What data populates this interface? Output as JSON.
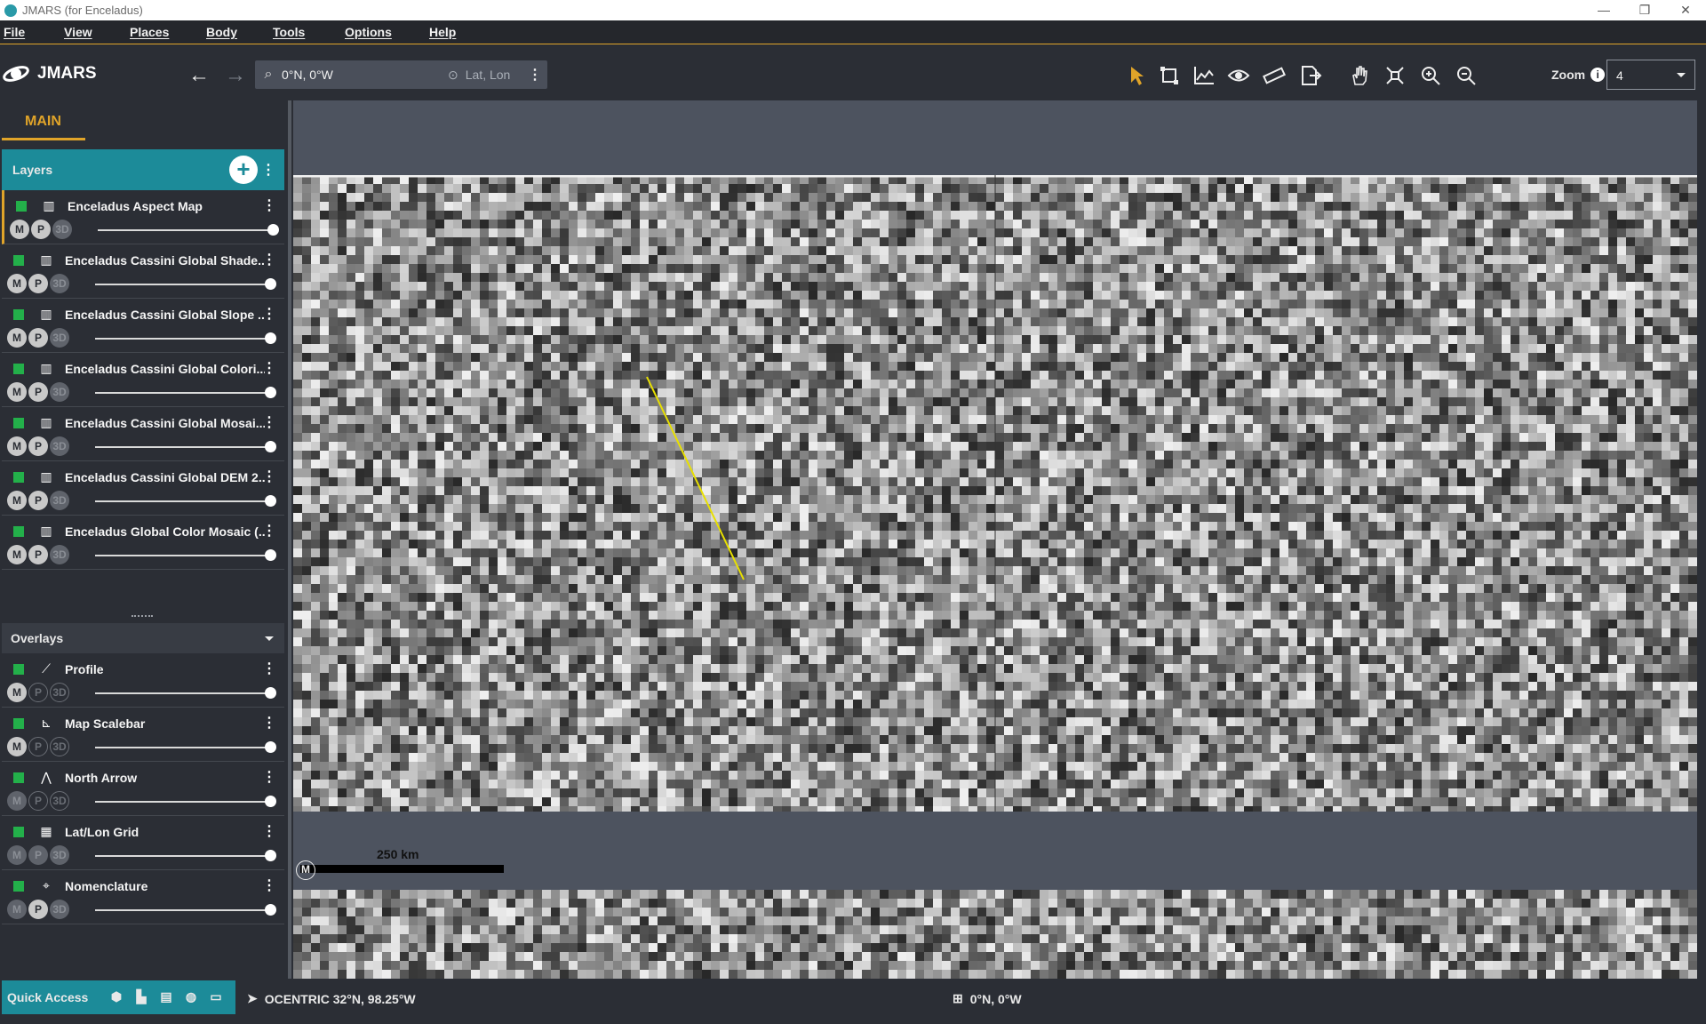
{
  "window": {
    "title": "JMARS (for Enceladus)",
    "controls": [
      "—",
      "❐",
      "✕"
    ]
  },
  "menu": [
    "File",
    "View",
    "Places",
    "Body",
    "Tools",
    "Options",
    "Help"
  ],
  "app": {
    "logo_text": "JMARS"
  },
  "search": {
    "value": "0°N, 0°W",
    "mode": "Lat, Lon"
  },
  "zoom": {
    "label": "Zoom",
    "value": "4"
  },
  "tabs": {
    "main": "MAIN"
  },
  "layers_header": "Layers",
  "layers": [
    {
      "name": "Enceladus Aspect Map",
      "badges": [
        "M",
        "P",
        "3D"
      ]
    },
    {
      "name": "Enceladus Cassini Global Shade...",
      "badges": [
        "M",
        "P",
        "3D"
      ]
    },
    {
      "name": "Enceladus Cassini Global Slope ...",
      "badges": [
        "M",
        "P",
        "3D"
      ]
    },
    {
      "name": "Enceladus Cassini Global Colori...",
      "badges": [
        "M",
        "P",
        "3D"
      ]
    },
    {
      "name": "Enceladus Cassini Global Mosai...",
      "badges": [
        "M",
        "P",
        "3D"
      ]
    },
    {
      "name": "Enceladus Cassini Global DEM 2...",
      "badges": [
        "M",
        "P",
        "3D"
      ]
    },
    {
      "name": "Enceladus Global Color Mosaic (...",
      "badges": [
        "M",
        "P",
        "3D"
      ]
    }
  ],
  "overlays_header": "Overlays",
  "overlays": [
    {
      "name": "Profile",
      "badges": [
        "M",
        "P",
        "3D"
      ]
    },
    {
      "name": "Map Scalebar",
      "badges": [
        "M",
        "P",
        "3D"
      ]
    },
    {
      "name": "North Arrow",
      "badges": [
        "M",
        "P",
        "3D"
      ]
    },
    {
      "name": "Lat/Lon Grid",
      "badges": [
        "M",
        "P",
        "3D"
      ]
    },
    {
      "name": "Nomenclature",
      "badges": [
        "M",
        "P",
        "3D"
      ]
    }
  ],
  "map": {
    "scalebar_label": "250 km",
    "mode_badge": "M"
  },
  "status": {
    "quick_access": "Quick Access",
    "cursor_coords": "OCENTRIC 32°N, 98.25°W",
    "center_coords": "0°N, 0°W"
  },
  "colors": {
    "accent": "#e0a429",
    "teal": "#1c8b99",
    "visible_check": "#23b04a"
  }
}
